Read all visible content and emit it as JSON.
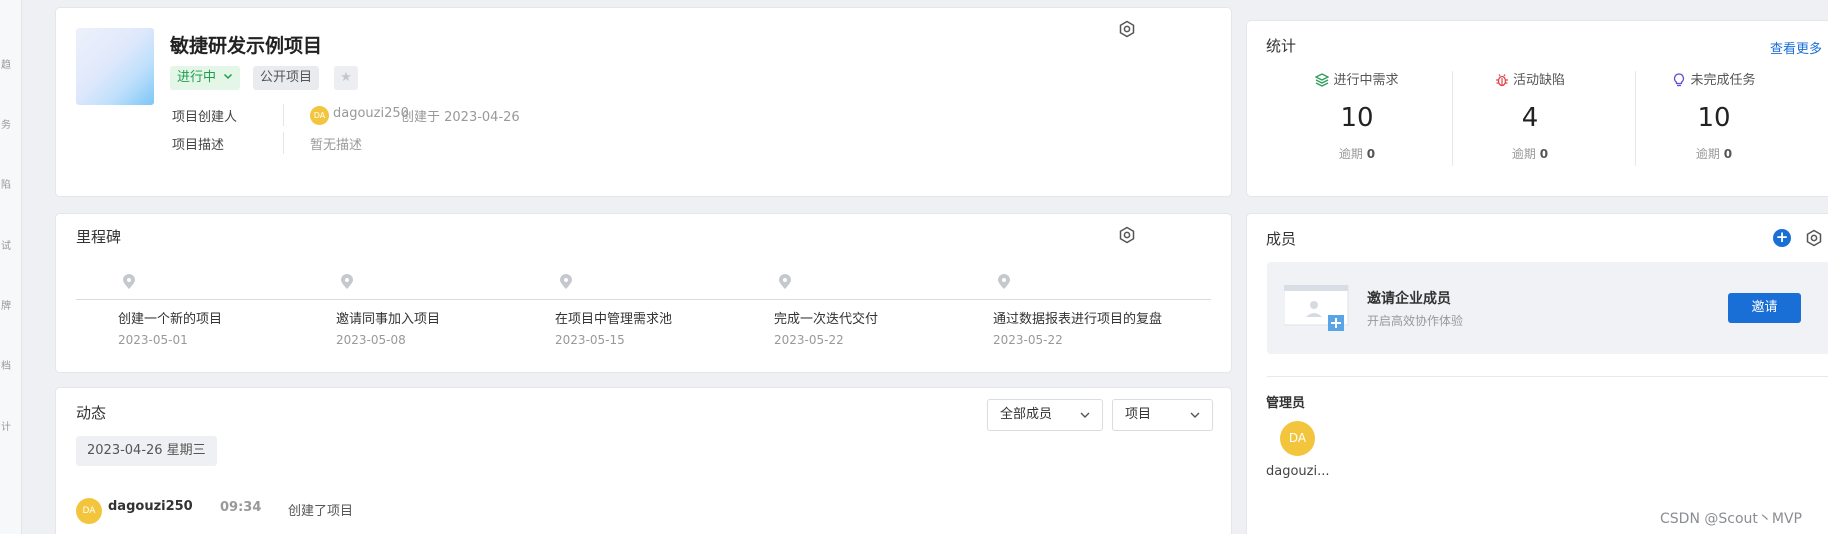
{
  "project": {
    "name": "敏捷研发示例项目",
    "status": "进行中",
    "visibility": "公开项目",
    "creator_label": "项目创建人",
    "creator_avatar": "DA",
    "creator_name": "dagouzi250",
    "created_text": "创建于 2023-04-26",
    "desc_label": "项目描述",
    "desc_value": "暂无描述"
  },
  "milestones": {
    "title": "里程碑",
    "items": [
      {
        "title": "创建一个新的项目",
        "date": "2023-05-01"
      },
      {
        "title": "邀请同事加入项目",
        "date": "2023-05-08"
      },
      {
        "title": "在项目中管理需求池",
        "date": "2023-05-15"
      },
      {
        "title": "完成一次迭代交付",
        "date": "2023-05-22"
      },
      {
        "title": "通过数据报表进行项目的复盘",
        "date": "2023-05-22"
      }
    ]
  },
  "activity": {
    "title": "动态",
    "filter_members": "全部成员",
    "filter_scope": "项目",
    "date_chip": "2023-04-26 星期三",
    "entries": [
      {
        "avatar": "DA",
        "user": "dagouzi250",
        "time": "09:34",
        "text": "创建了项目"
      }
    ]
  },
  "stats": {
    "title": "统计",
    "more": "查看更多",
    "columns": [
      {
        "label": "进行中需求",
        "value": "10",
        "overdue_label": "逾期",
        "overdue": "0",
        "icon": "layers-icon",
        "color": "#2f9e5b"
      },
      {
        "label": "活动缺陷",
        "value": "4",
        "overdue_label": "逾期",
        "overdue": "0",
        "icon": "bug-icon",
        "color": "#e0474c"
      },
      {
        "label": "未完成任务",
        "value": "10",
        "overdue_label": "逾期",
        "overdue": "0",
        "icon": "bulb-icon",
        "color": "#5b4fd6"
      }
    ]
  },
  "members": {
    "title": "成员",
    "invite_title": "邀请企业成员",
    "invite_sub": "开启高效协作体验",
    "invite_button": "邀请",
    "admin_label": "管理员",
    "admin_avatar": "DA",
    "admin_name": "dagouzi..."
  },
  "leftbar_glyphs": [
    "趋",
    "务",
    "陷",
    "试",
    "牌",
    "档",
    "计"
  ],
  "watermark": "CSDN @Scout丶MVP",
  "colors": {
    "accent": "#1a6fd6",
    "status_green": "#1e9e4a",
    "avatar": "#f2c53d"
  }
}
